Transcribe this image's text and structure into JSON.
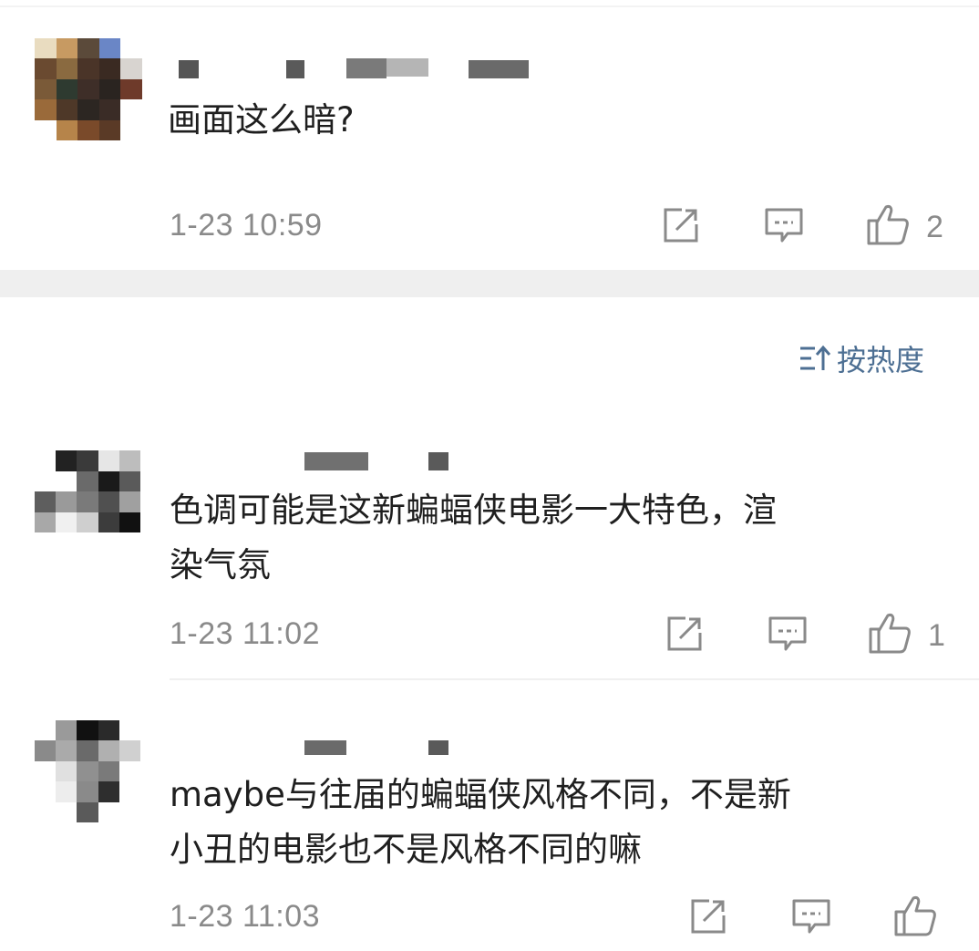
{
  "colors": {
    "text": "#1f1f1f",
    "meta": "#8a8a8a",
    "icon": "#8a8a8a",
    "sort": "#4d6f93",
    "separator": "#efefef"
  },
  "sort": {
    "icon": "sort-icon",
    "label": "按热度"
  },
  "comments": [
    {
      "text": "画面这么暗?",
      "time": "1-23  10:59",
      "likes": "2"
    },
    {
      "text": "色调可能是这新蝙蝠侠电影一大特色，渲\n染气氛",
      "time": "1-23  11:02",
      "likes": "1"
    },
    {
      "text": "maybe与往届的蝙蝠侠风格不同，不是新\n小丑的电影也不是风格不同的嘛",
      "time": "1-23  11:03",
      "likes": ""
    }
  ],
  "icons": {
    "share": "share-icon",
    "reply": "comment-icon",
    "like": "thumbs-up-icon"
  }
}
